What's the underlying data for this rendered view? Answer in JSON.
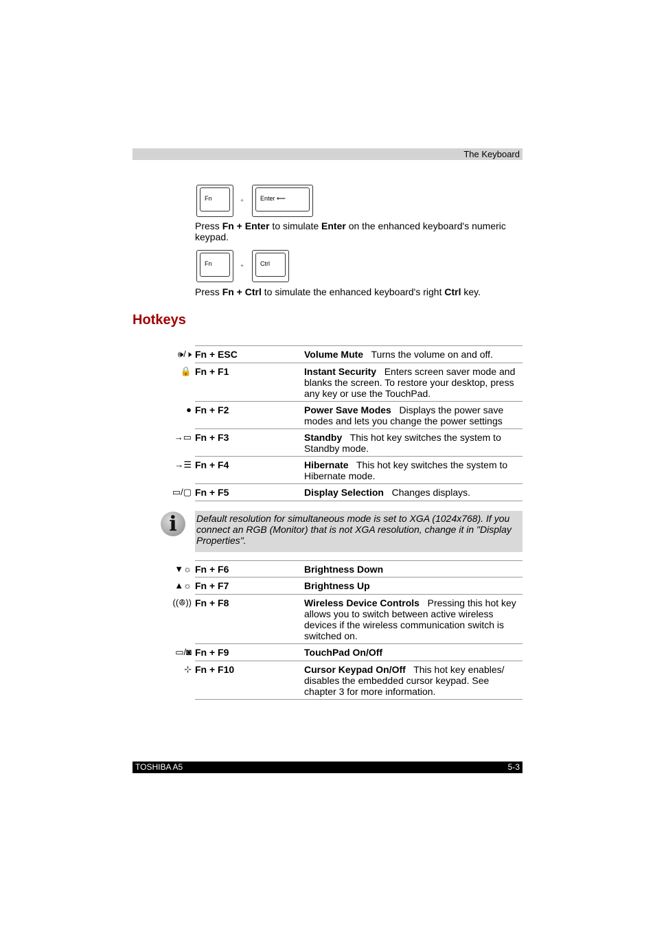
{
  "header": {
    "section": "The Keyboard"
  },
  "keys": {
    "fn": "Fn",
    "enter": "Enter ⟵",
    "ctrl": "Ctrl",
    "plus": "+"
  },
  "para1": {
    "pre": "Press ",
    "b1": "Fn + Enter",
    "mid": " to simulate ",
    "b2": "Enter",
    "post": " on the enhanced keyboard's numeric keypad."
  },
  "para2": {
    "pre": "Press ",
    "b1": "Fn + Ctrl",
    "mid": " to simulate the enhanced keyboard's right ",
    "b2": "Ctrl",
    "post": " key."
  },
  "title": "Hotkeys",
  "rows1": [
    {
      "icon": "speaker-mute-icon",
      "glyph": "🕪/🕨",
      "key": "Fn + ESC",
      "name": "Volume Mute",
      "desc": "Turns the volume on and off."
    },
    {
      "icon": "lock-icon",
      "glyph": "🔒",
      "key": "Fn + F1",
      "name": "Instant Security",
      "desc": "Enters screen saver mode and blanks the screen. To restore your desktop, press any key or use the TouchPad."
    },
    {
      "icon": "power-save-icon",
      "glyph": "●",
      "key": "Fn + F2",
      "name": "Power Save Modes",
      "desc": "Displays the power save modes and lets you change the power settings"
    },
    {
      "icon": "standby-icon",
      "glyph": "→▭",
      "key": "Fn + F3",
      "name": "Standby",
      "desc": "This hot key switches the system to Standby mode."
    },
    {
      "icon": "hibernate-icon",
      "glyph": "→☰",
      "key": "Fn + F4",
      "name": "Hibernate",
      "desc": "This hot key switches the system to Hibernate mode."
    },
    {
      "icon": "display-icon",
      "glyph": "▭/▢",
      "key": "Fn + F5",
      "name": "Display Selection",
      "desc": "Changes displays."
    }
  ],
  "note": "Default resolution for simultaneous mode is set to XGA (1024x768). If you connect an RGB (Monitor) that is not XGA resolution, change it in \"Display Properties\".",
  "rows2": [
    {
      "icon": "brightness-down-icon",
      "glyph": "▼☼",
      "key": "Fn + F6",
      "name": "Brightness Down",
      "desc": ""
    },
    {
      "icon": "brightness-up-icon",
      "glyph": "▲☼",
      "key": "Fn + F7",
      "name": "Brightness Up",
      "desc": ""
    },
    {
      "icon": "wireless-icon",
      "glyph": "((ꔮ))",
      "key": "Fn + F8",
      "name": "Wireless Device Controls",
      "desc": "Pressing this hot key allows you to switch between active wireless devices if the wireless communication switch is switched on."
    },
    {
      "icon": "touchpad-icon",
      "glyph": "▭/◙",
      "key": "Fn + F9",
      "name": "TouchPad On/Off",
      "desc": ""
    },
    {
      "icon": "cursor-keypad-icon",
      "glyph": "⊹",
      "key": "Fn + F10",
      "name": "Cursor Keypad On/Off",
      "desc": "This hot key enables/ disables the embedded cursor keypad. See chapter 3 for more information."
    }
  ],
  "footer": {
    "left": "TOSHIBA A5",
    "right": "5-3"
  }
}
